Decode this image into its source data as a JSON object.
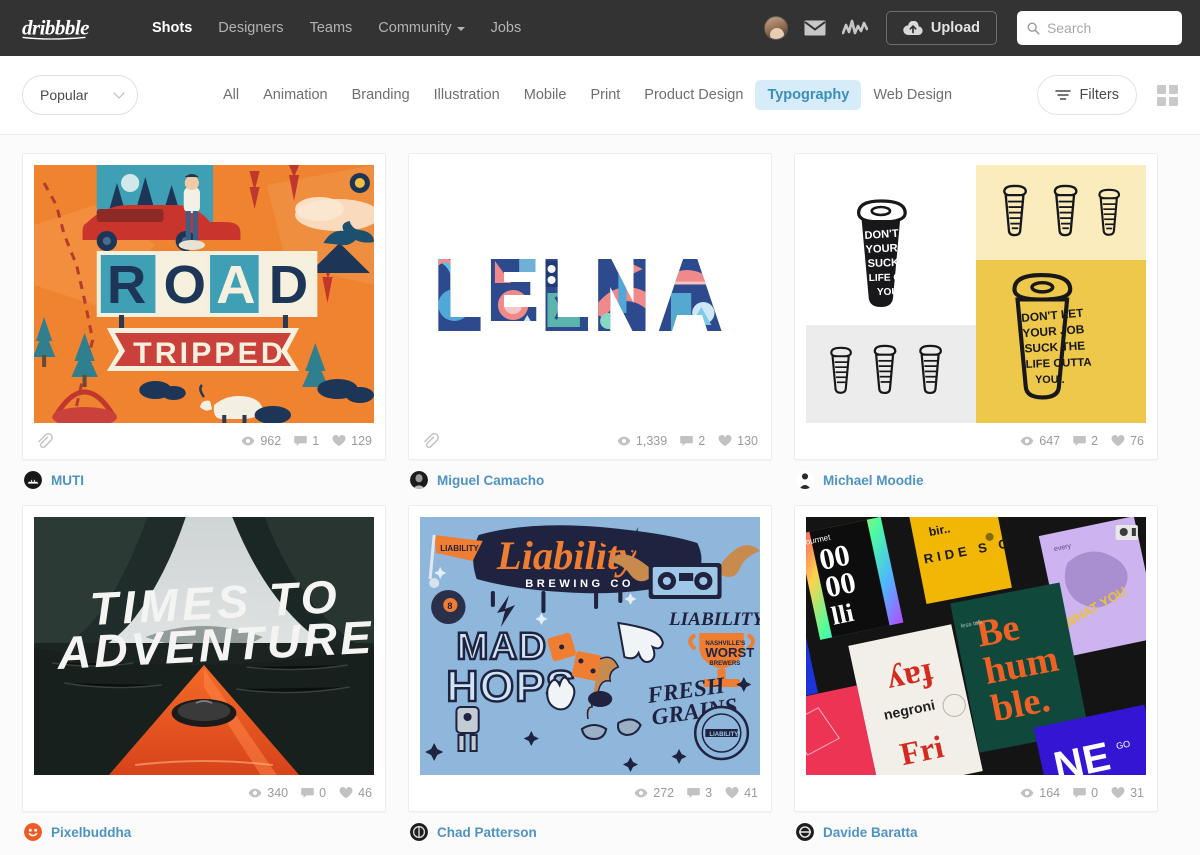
{
  "header": {
    "logo_alt": "dribbble",
    "nav": [
      {
        "label": "Shots",
        "active": true,
        "caret": false
      },
      {
        "label": "Designers",
        "active": false,
        "caret": false
      },
      {
        "label": "Teams",
        "active": false,
        "caret": false
      },
      {
        "label": "Community",
        "active": false,
        "caret": true
      },
      {
        "label": "Jobs",
        "active": false,
        "caret": false
      }
    ],
    "avatar_name": "user-avatar",
    "mail_icon": "envelope-icon",
    "activity_icon": "activity-icon",
    "upload_label": "Upload",
    "search_placeholder": "Search",
    "search_value": "",
    "bg_color": "#333333"
  },
  "filterbar": {
    "sort_label": "Popular",
    "categories": [
      {
        "label": "All",
        "active": false
      },
      {
        "label": "Animation",
        "active": false
      },
      {
        "label": "Branding",
        "active": false
      },
      {
        "label": "Illustration",
        "active": false
      },
      {
        "label": "Mobile",
        "active": false
      },
      {
        "label": "Print",
        "active": false
      },
      {
        "label": "Product Design",
        "active": false
      },
      {
        "label": "Typography",
        "active": true
      },
      {
        "label": "Web Design",
        "active": false
      }
    ],
    "filters_label": "Filters",
    "grid_toggle_name": "grid-view-toggle",
    "active_accent": "#3b8dbd",
    "active_bg": "#d6ecf8"
  },
  "shots": [
    {
      "id": "road-tripped",
      "title": "ROAD TRIPPED",
      "has_attachment": true,
      "views": "962",
      "comments": "1",
      "likes": "129",
      "author": "MUTI",
      "art": {
        "words": [
          "ROAD",
          "TRIPPED"
        ],
        "bg": "#f0822e"
      }
    },
    {
      "id": "elena",
      "title": "ELENA",
      "has_attachment": true,
      "views": "1,339",
      "comments": "2",
      "likes": "130",
      "author": "Miguel Camacho",
      "art": {
        "words": [
          "ELENA"
        ],
        "bg": "#ffffff"
      }
    },
    {
      "id": "coffee-lettering",
      "title": "DON'T LET YOUR JOB SUCK THE LIFE OUTTA YOU..",
      "has_attachment": false,
      "views": "647",
      "comments": "2",
      "likes": "76",
      "author": "Michael Moodie",
      "art": {
        "words": [
          "DON'T LET",
          "YOUR JOB",
          "SUCK THE",
          "LIFE OUTTA",
          "YOU.."
        ],
        "bg": "#e8c githubusercontent"
      }
    },
    {
      "id": "times-to-adventure",
      "title": "TIMES TO ADVENTURE",
      "has_attachment": false,
      "views": "340",
      "comments": "0",
      "likes": "46",
      "author": "Pixelbuddha",
      "art": {
        "words": [
          "TIMES TO",
          "ADVENTURE"
        ],
        "bg": "#27302f"
      }
    },
    {
      "id": "liability-brewing",
      "title": "Liability Brewing Co",
      "has_attachment": false,
      "views": "272",
      "comments": "3",
      "likes": "41",
      "author": "Chad Patterson",
      "art": {
        "words": [
          "Liability",
          "BREWING CO",
          "MAD",
          "HOPS",
          "FRESH GRAINS",
          "LIABILITY",
          "WORST"
        ],
        "bg": "#8db3d8"
      }
    },
    {
      "id": "poster-collage",
      "title": "Be hum ble.",
      "has_attachment": false,
      "views": "164",
      "comments": "0",
      "likes": "31",
      "author": "Davide Baratta",
      "art": {
        "words": [
          "Be",
          "hum",
          "ble.",
          "negroni",
          "RIDE SO",
          "NE"
        ],
        "bg": "#111111"
      }
    }
  ]
}
